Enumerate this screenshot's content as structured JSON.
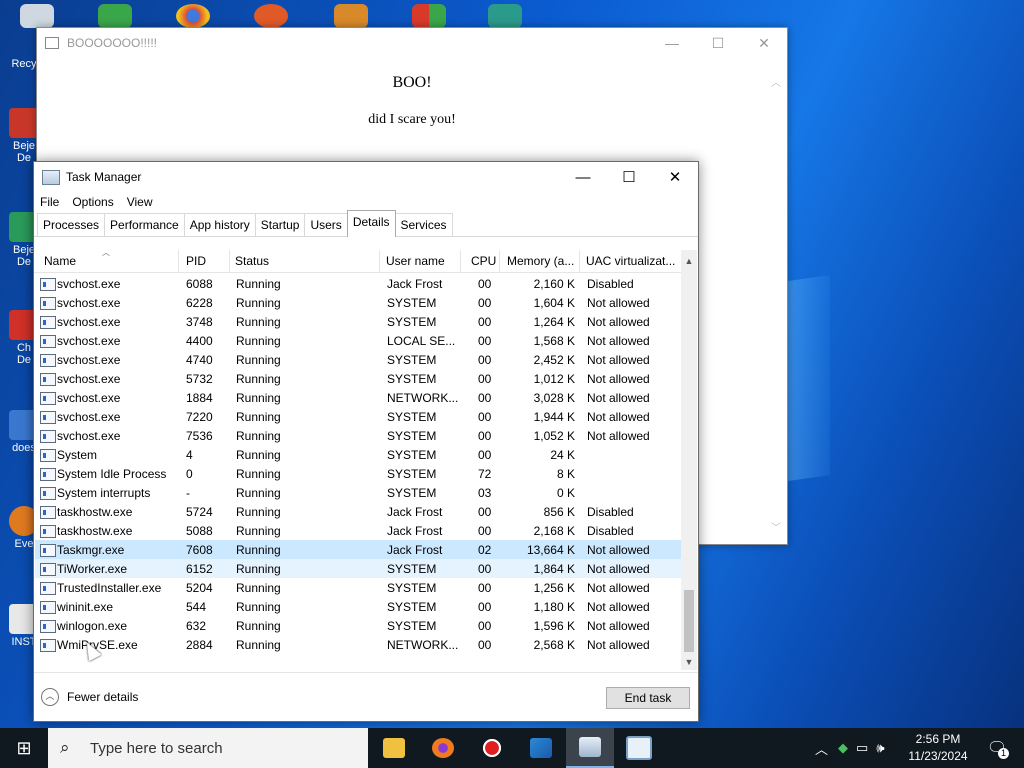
{
  "desktop": {
    "labels": [
      "Recy",
      "Beje",
      "De",
      "Beje",
      "De",
      "Ch",
      "De",
      "does",
      "Eve",
      "INST"
    ]
  },
  "boo_window": {
    "title": "BOOOOOOO!!!!!",
    "heading": "BOO!",
    "message": "did I scare you!",
    "controls": {
      "minimize": "—",
      "maximize": "☐",
      "close": "✕"
    }
  },
  "task_manager": {
    "title": "Task Manager",
    "controls": {
      "minimize": "—",
      "maximize": "☐",
      "close": "✕"
    },
    "menu": [
      "File",
      "Options",
      "View"
    ],
    "tabs": [
      "Processes",
      "Performance",
      "App history",
      "Startup",
      "Users",
      "Details",
      "Services"
    ],
    "active_tab": "Details",
    "columns": [
      "Name",
      "PID",
      "Status",
      "User name",
      "CPU",
      "Memory (a...",
      "UAC virtualizat..."
    ],
    "rows": [
      {
        "name": "svchost.exe",
        "pid": "6088",
        "status": "Running",
        "user": "Jack Frost",
        "cpu": "00",
        "mem": "2,160 K",
        "uac": "Disabled"
      },
      {
        "name": "svchost.exe",
        "pid": "6228",
        "status": "Running",
        "user": "SYSTEM",
        "cpu": "00",
        "mem": "1,604 K",
        "uac": "Not allowed"
      },
      {
        "name": "svchost.exe",
        "pid": "3748",
        "status": "Running",
        "user": "SYSTEM",
        "cpu": "00",
        "mem": "1,264 K",
        "uac": "Not allowed"
      },
      {
        "name": "svchost.exe",
        "pid": "4400",
        "status": "Running",
        "user": "LOCAL SE...",
        "cpu": "00",
        "mem": "1,568 K",
        "uac": "Not allowed"
      },
      {
        "name": "svchost.exe",
        "pid": "4740",
        "status": "Running",
        "user": "SYSTEM",
        "cpu": "00",
        "mem": "2,452 K",
        "uac": "Not allowed"
      },
      {
        "name": "svchost.exe",
        "pid": "5732",
        "status": "Running",
        "user": "SYSTEM",
        "cpu": "00",
        "mem": "1,012 K",
        "uac": "Not allowed"
      },
      {
        "name": "svchost.exe",
        "pid": "1884",
        "status": "Running",
        "user": "NETWORK...",
        "cpu": "00",
        "mem": "3,028 K",
        "uac": "Not allowed"
      },
      {
        "name": "svchost.exe",
        "pid": "7220",
        "status": "Running",
        "user": "SYSTEM",
        "cpu": "00",
        "mem": "1,944 K",
        "uac": "Not allowed"
      },
      {
        "name": "svchost.exe",
        "pid": "7536",
        "status": "Running",
        "user": "SYSTEM",
        "cpu": "00",
        "mem": "1,052 K",
        "uac": "Not allowed"
      },
      {
        "name": "System",
        "pid": "4",
        "status": "Running",
        "user": "SYSTEM",
        "cpu": "00",
        "mem": "24 K",
        "uac": ""
      },
      {
        "name": "System Idle Process",
        "pid": "0",
        "status": "Running",
        "user": "SYSTEM",
        "cpu": "72",
        "mem": "8 K",
        "uac": ""
      },
      {
        "name": "System interrupts",
        "pid": "-",
        "status": "Running",
        "user": "SYSTEM",
        "cpu": "03",
        "mem": "0 K",
        "uac": ""
      },
      {
        "name": "taskhostw.exe",
        "pid": "5724",
        "status": "Running",
        "user": "Jack Frost",
        "cpu": "00",
        "mem": "856 K",
        "uac": "Disabled"
      },
      {
        "name": "taskhostw.exe",
        "pid": "5088",
        "status": "Running",
        "user": "Jack Frost",
        "cpu": "00",
        "mem": "2,168 K",
        "uac": "Disabled"
      },
      {
        "name": "Taskmgr.exe",
        "pid": "7608",
        "status": "Running",
        "user": "Jack Frost",
        "cpu": "02",
        "mem": "13,664 K",
        "uac": "Not allowed"
      },
      {
        "name": "TiWorker.exe",
        "pid": "6152",
        "status": "Running",
        "user": "SYSTEM",
        "cpu": "00",
        "mem": "1,864 K",
        "uac": "Not allowed"
      },
      {
        "name": "TrustedInstaller.exe",
        "pid": "5204",
        "status": "Running",
        "user": "SYSTEM",
        "cpu": "00",
        "mem": "1,256 K",
        "uac": "Not allowed"
      },
      {
        "name": "wininit.exe",
        "pid": "544",
        "status": "Running",
        "user": "SYSTEM",
        "cpu": "00",
        "mem": "1,180 K",
        "uac": "Not allowed"
      },
      {
        "name": "winlogon.exe",
        "pid": "632",
        "status": "Running",
        "user": "SYSTEM",
        "cpu": "00",
        "mem": "1,596 K",
        "uac": "Not allowed"
      },
      {
        "name": "WmiPrvSE.exe",
        "pid": "2884",
        "status": "Running",
        "user": "NETWORK...",
        "cpu": "00",
        "mem": "2,568 K",
        "uac": "Not allowed"
      }
    ],
    "selected_row": "Taskmgr.exe",
    "hovered_row": "TiWorker.exe",
    "fewer_details": "Fewer details",
    "end_task": "End task"
  },
  "taskbar": {
    "search_placeholder": "Type here to search",
    "time": "2:56 PM",
    "date": "11/23/2024",
    "notification_count": "1"
  },
  "colors": {
    "selected_row": "#cce8ff",
    "hover_row": "#e5f3ff",
    "taskbar": "#101820"
  }
}
